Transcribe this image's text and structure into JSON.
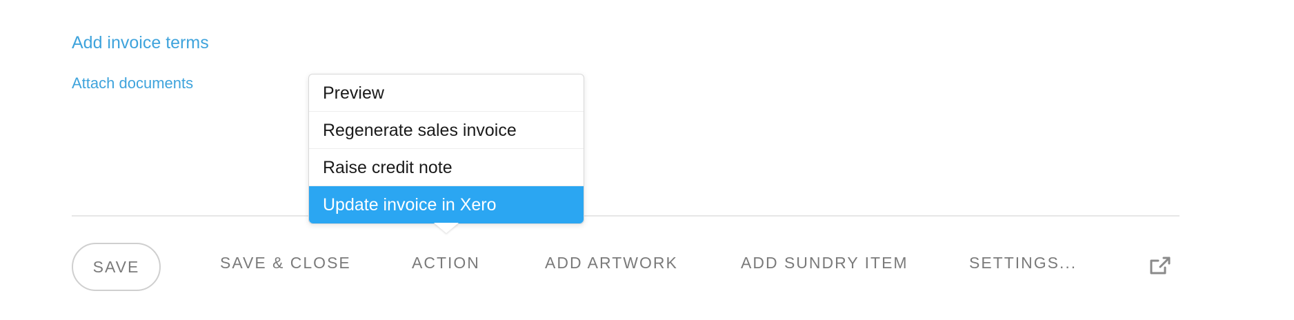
{
  "links": {
    "add_invoice_terms": "Add invoice terms",
    "attach_documents": "Attach documents"
  },
  "action_menu": {
    "items": [
      {
        "label": "Preview"
      },
      {
        "label": "Regenerate sales invoice"
      },
      {
        "label": "Raise credit note"
      },
      {
        "label": "Update invoice in Xero",
        "selected": true
      }
    ]
  },
  "toolbar": {
    "save": "SAVE",
    "save_close": "SAVE & CLOSE",
    "action": "ACTION",
    "add_artwork": "ADD ARTWORK",
    "add_sundry_item": "ADD SUNDRY ITEM",
    "settings": "SETTINGS...",
    "open_external_icon": "external-link-icon"
  },
  "colors": {
    "link": "#3ea3dc",
    "selected_item_bg": "#2ba6f2",
    "toolbar_text": "#7a7a7a"
  }
}
